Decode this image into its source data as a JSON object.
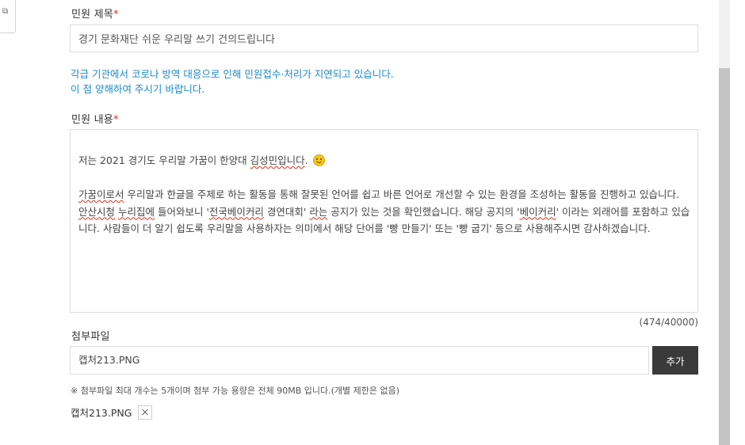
{
  "sidebar": {
    "tab_icon": "external-link-icon",
    "tab_glyph": "⧉"
  },
  "form": {
    "title_label": "민원 제목",
    "required_mark": "*",
    "title_value": "경기 문화재단 쉬운 우리말 쓰기 건의드립니다",
    "notice_line1": "각급 기관에서 코로나 방역 대응으로 인해 민원접수·처리가 지연되고 있습니다.",
    "notice_line2": "이 점 양해하여 주시기 바랍니다.",
    "content_label": "민원 내용",
    "content": {
      "p1_a": "저는 2021 경기도 우리말 가꿈이 한양대 ",
      "p1_b": "김성민입니다",
      "p1_c": ".",
      "p2_a": "가꿈이로서",
      "p2_b": " 우리말과 한글을 주제로 하는 활동을 통해 잘못된 언어를 쉽고 바른 언어로 개선할 수 있는 환경을 조성하는 활동을 진행하고 있습니다.",
      "p3_a": "안산시청",
      "p3_b": " ",
      "p3_c": "누리집에",
      "p3_d": " 들어와보니 '",
      "p3_e": "전국베이커리",
      "p3_f": " 경연대회' ",
      "p3_g": "라는",
      "p3_h": " 공지가 있는 것을 확인했습니다. 해당 공지의 '",
      "p3_i": "베이커리",
      "p3_j": "' 이라는 외래어를 포함하고 있습니다. 사람들이 더 알기 쉽도록 우리말을 사용하자는 의미에서 해당 단어를 '빵 만들기' 또는 '빵 굽기' 등으로 사용해주시면 감사하겠습니다."
    },
    "char_counter": "(474/40000)",
    "attach_label": "첨부파일",
    "attach_value": "캡처213.PNG",
    "add_button": "추가",
    "attach_note": "※ 첨부파일 최대 개수는 5개이며 첨부 가능 용량은 전체 90MB 입니다.(개별 제한은 없음)",
    "attached_file": "캡처213.PNG"
  },
  "colors": {
    "notice": "#1a8ad1",
    "required": "#e0301e",
    "button_bg": "#3a3a3a"
  }
}
